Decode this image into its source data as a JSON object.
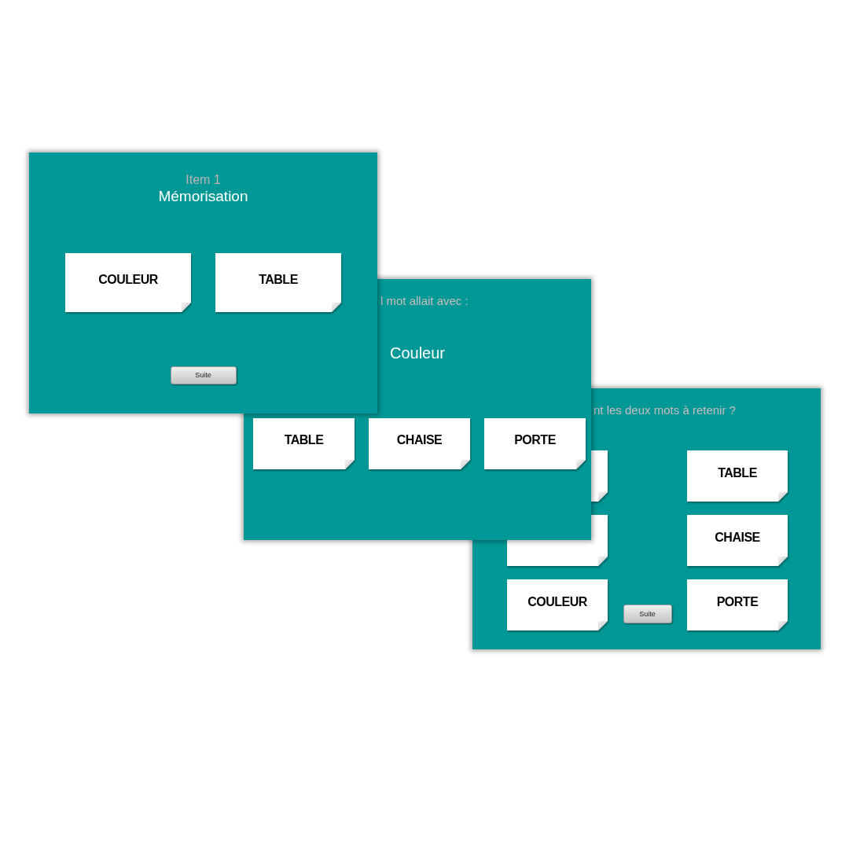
{
  "slides": [
    {
      "kind": "memorize",
      "item": "Item 1",
      "title": "Mémorisation",
      "cards": [
        "COULEUR",
        "TABLE"
      ],
      "button": "Suite"
    },
    {
      "kind": "match",
      "heading": "l mot allait avec :",
      "prompt": "Couleur",
      "cards": [
        "TABLE",
        "CHAISE",
        "PORTE"
      ]
    },
    {
      "kind": "recall",
      "heading": "nt les deux mots à retenir ?",
      "rows": [
        {
          "right": "TABLE"
        },
        {
          "right": "CHAISE"
        },
        {
          "left": "COULEUR",
          "right": "PORTE"
        }
      ],
      "button": "Suite"
    }
  ]
}
